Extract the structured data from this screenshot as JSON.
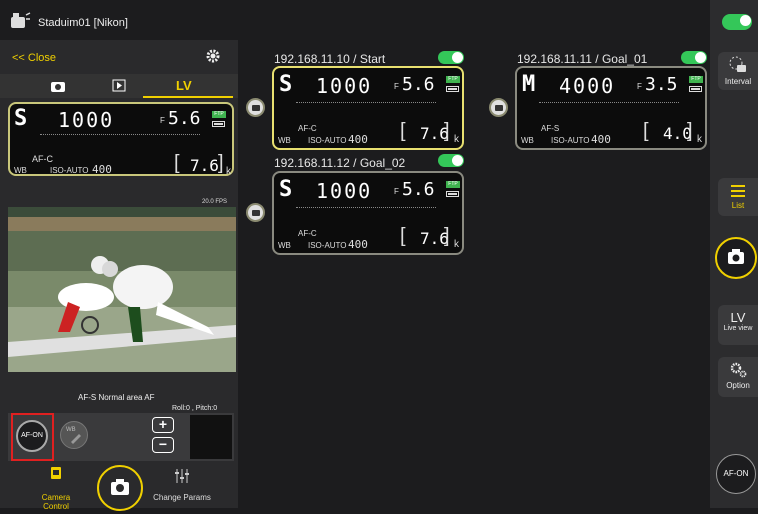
{
  "top_bar": {
    "title": "Staduim01 [Nikon]"
  },
  "left_panel": {
    "close_label": "<< Close",
    "tabs": [
      "",
      "",
      "LV"
    ],
    "fps": "20.0 FPS",
    "af_status": "AF-S  Normal area AF",
    "roll_pitch": "Roll:0 , Pitch:0",
    "af_on_label": "AF-ON",
    "wb_label": "WB",
    "plus": "+",
    "minus": "−",
    "bottom_tabs": [
      "Camera Control",
      "Change Params"
    ]
  },
  "cameras": [
    {
      "ip": "192.168.11.10 / Start",
      "mode": "S",
      "shutter": "1000",
      "fnum": "5.6",
      "af": "AF-C",
      "iso": "ISO-AUTO",
      "iso_val": "400",
      "remain": "7.6",
      "k": "k"
    },
    {
      "ip": "192.168.11.12 / Goal_02",
      "mode": "S",
      "shutter": "1000",
      "fnum": "5.6",
      "af": "AF-C",
      "iso": "ISO-AUTO",
      "iso_val": "400",
      "remain": "7.6",
      "k": "k"
    },
    {
      "ip": "192.168.11.11 / Goal_01",
      "mode": "M",
      "shutter": "4000",
      "fnum": "3.5",
      "af": "AF-S",
      "iso": "ISO-AUTO",
      "iso_val": "400",
      "remain": "4.0",
      "k": "k"
    }
  ],
  "left_lcd": {
    "mode": "S",
    "shutter": "1000",
    "fnum": "5.6",
    "af": "AF-C",
    "iso": "ISO-AUTO",
    "iso_val": "400",
    "remain": "7.6",
    "k": "k"
  },
  "right_sidebar": {
    "interval": "Interval",
    "list": "List",
    "lv": "LV",
    "live_view": "Live view",
    "option": "Option",
    "af_on": "AF-ON"
  },
  "colors": {
    "accent_green": "#34c759",
    "highlight_yellow": "#f0d000",
    "card_border": "#c9c77b"
  }
}
